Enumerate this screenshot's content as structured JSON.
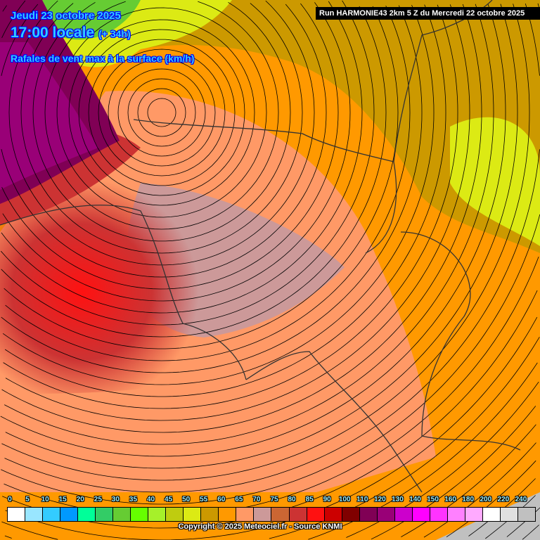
{
  "header": {
    "date": "Jeudi 23 octobre 2025",
    "time": "17:00 locale",
    "lead": "(+ 34h)",
    "parameter": "Rafales de vent max à la surface (km/h)",
    "run": "Run HARMONIE43 2km 5 Z du Mercredi 22 octobre 2025"
  },
  "legend": {
    "labels": [
      "0",
      "5",
      "10",
      "15",
      "20",
      "25",
      "30",
      "35",
      "40",
      "45",
      "50",
      "55",
      "60",
      "65",
      "70",
      "75",
      "80",
      "85",
      "90",
      "100",
      "110",
      "120",
      "130",
      "140",
      "150",
      "160",
      "180",
      "200",
      "220",
      "240"
    ],
    "colors": [
      "#ffffff",
      "#99e6ff",
      "#33ccff",
      "#0099ff",
      "#00ff99",
      "#33cc66",
      "#66cc33",
      "#66ff00",
      "#a6f02a",
      "#bfcc0f",
      "#dcea14",
      "#cc9900",
      "#ff9900",
      "#ff9966",
      "#cc9999",
      "#cc6633",
      "#cc3333",
      "#ff1111",
      "#cc0000",
      "#800000",
      "#800055",
      "#990077",
      "#cc00cc",
      "#ff00ff",
      "#ff33ff",
      "#ff80ff",
      "#ffaaff",
      "#ffffff",
      "#e0e0e0",
      "#c0c0c0"
    ]
  },
  "copyright": "Copyright © 2025 Meteociel.fr - Source KNMI"
}
